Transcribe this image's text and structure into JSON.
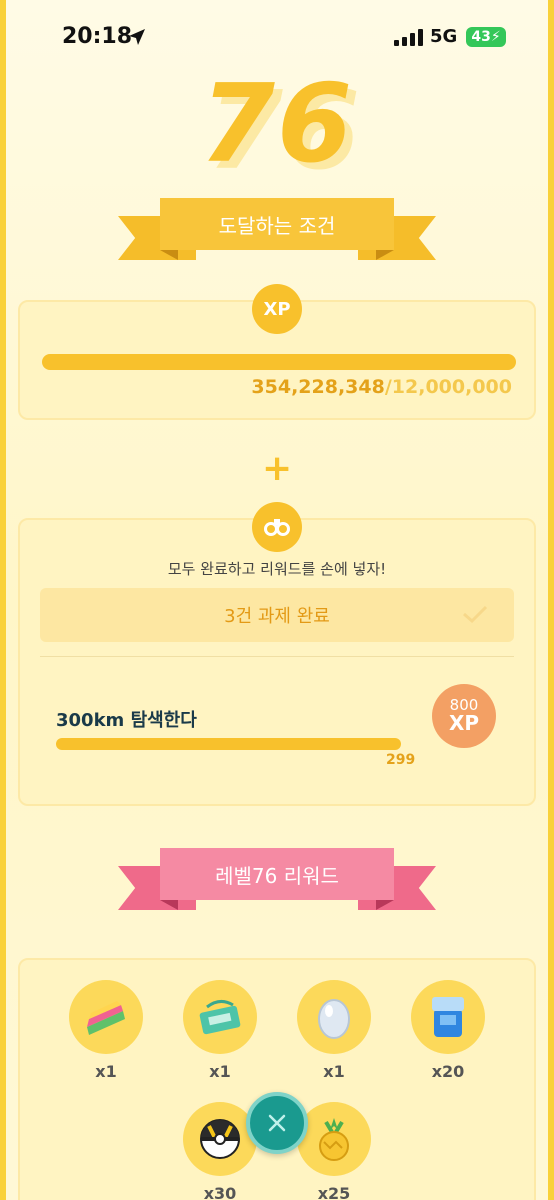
{
  "status_bar": {
    "time": "20:18",
    "network": "5G",
    "battery": "43"
  },
  "level": {
    "number": "76",
    "requirements_title": "도달하는 조건"
  },
  "xp_card": {
    "badge": "XP",
    "current": "354,228,348",
    "separator": "/",
    "required": "12,000,000",
    "progress": 1.0
  },
  "plus_symbol": "+",
  "task_card": {
    "badge_icon": "binoculars-icon",
    "intro": "모두 완료하고 리워드를 손에 넣자!",
    "completed_label": "3건 과제 완료",
    "task": {
      "title": "300km 탐색한다",
      "progress_value": "299",
      "progress": 0.997,
      "reward_amount": "800",
      "reward_unit": "XP"
    }
  },
  "rewards_ribbon": "레벨76 리워드",
  "rewards": [
    {
      "icon": "rainbow-cake-icon",
      "qty": "x1"
    },
    {
      "icon": "raid-pass-icon",
      "qty": "x1"
    },
    {
      "icon": "egg-icon",
      "qty": "x1"
    },
    {
      "icon": "incubator-icon",
      "qty": "x20"
    },
    {
      "icon": "ultra-ball-icon",
      "qty": "x30"
    },
    {
      "icon": "golden-pinap-berry-icon",
      "qty": "x25"
    }
  ],
  "colors": {
    "accent": "#f8c12c",
    "pink": "#f58aa3",
    "close": "#1a9a8f"
  }
}
